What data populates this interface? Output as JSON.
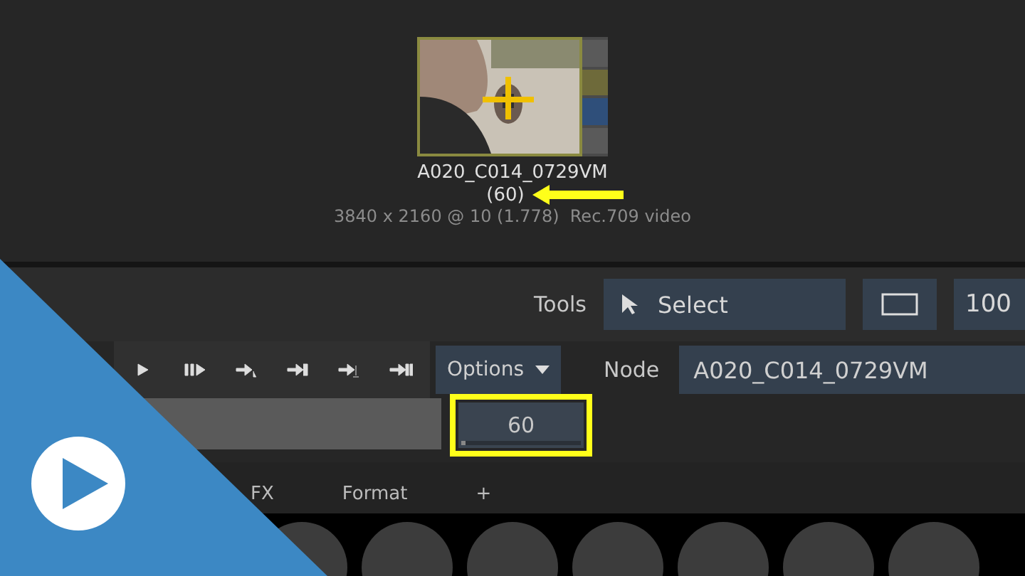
{
  "clip": {
    "name": "A020_C014_0729VM",
    "count": "(60)",
    "info": "3840 x 2160 @ 10 (1.778)  Rec.709 video",
    "swatches": [
      {
        "color": "#5a5a5a"
      },
      {
        "color": "#6e6a3a"
      },
      {
        "color": "#2f4f7a"
      },
      {
        "color": "#5a5a5a"
      }
    ]
  },
  "tools": {
    "label": "Tools",
    "select": "Select",
    "zoom": "100"
  },
  "transport": {
    "options": "Options",
    "node_label": "Node",
    "node": "A020_C014_0729VM",
    "value": "60",
    "level": 0.02
  },
  "tabs": [
    {
      "label": "FX",
      "selected": false
    },
    {
      "label": "Format",
      "selected": false
    },
    {
      "label": "+",
      "selected": false
    }
  ]
}
